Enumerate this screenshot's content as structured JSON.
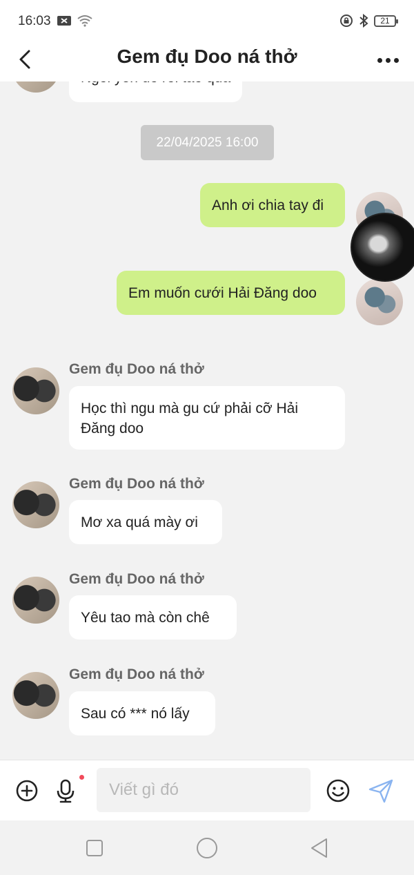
{
  "status_bar": {
    "time": "16:03",
    "battery": "21"
  },
  "header": {
    "title": "Gem đụ Doo ná thở"
  },
  "chat": {
    "partial_message": "Ngồi yên đó rồi tao qua",
    "timestamp": "22/04/2025 16:00",
    "outgoing": [
      {
        "text": "Anh ơi chia tay đi"
      },
      {
        "text": "Em muốn cưới Hải Đăng doo"
      }
    ],
    "incoming": [
      {
        "sender": "Gem đụ Doo ná thở",
        "text": "Học thì ngu mà gu cứ phải cỡ Hải Đăng doo"
      },
      {
        "sender": "Gem đụ Doo ná thở",
        "text": "Mơ xa quá mày ơi"
      },
      {
        "sender": "Gem đụ Doo ná thở",
        "text": "Yêu tao mà còn chê"
      },
      {
        "sender": "Gem đụ Doo ná thở",
        "text": "Sau có *** nó lấy"
      }
    ]
  },
  "input": {
    "placeholder": "Viết gì đó"
  },
  "colors": {
    "outgoing_bubble": "#cff08a",
    "incoming_bubble": "#ffffff",
    "background": "#f2f2f2",
    "send_icon": "#8ab4f0",
    "mic_dot": "#f14a5a"
  }
}
